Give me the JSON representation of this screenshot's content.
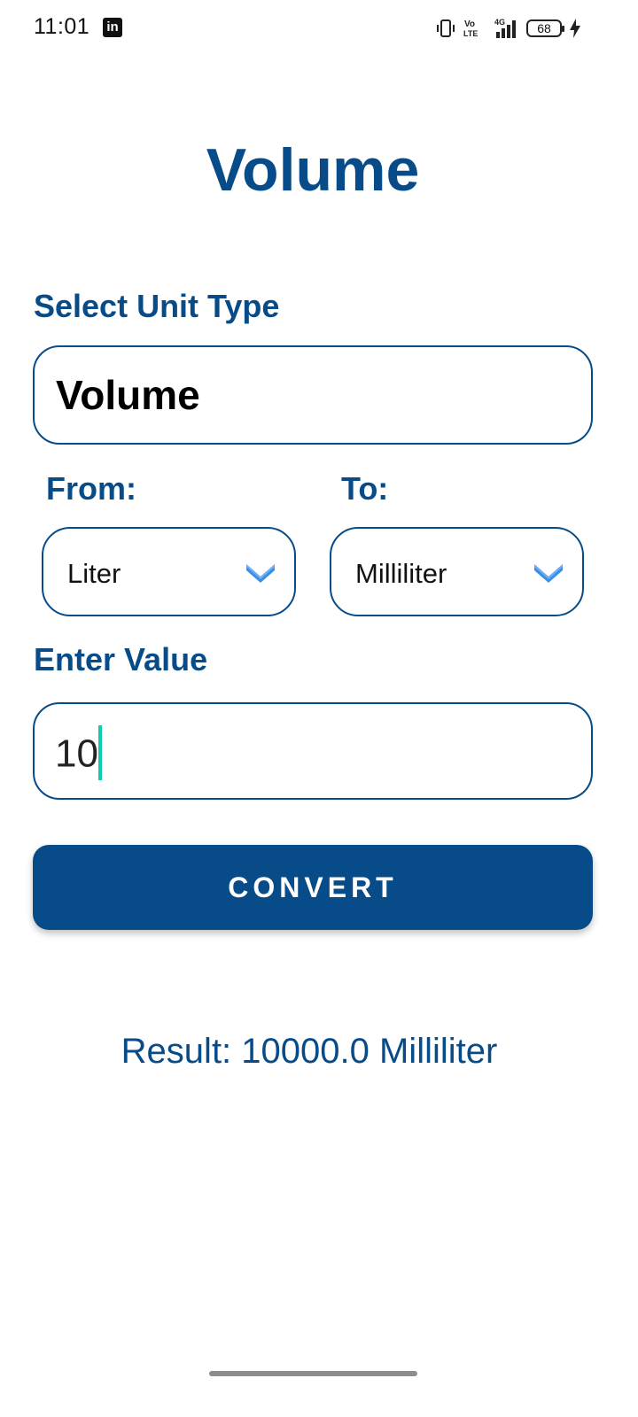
{
  "status_bar": {
    "time": "11:01",
    "notification_icon": "linkedin-icon",
    "linkedin_letters": "in",
    "volte_top": "Vo",
    "volte_bottom": "LTE",
    "network": "4G",
    "battery_level": "68",
    "icons": [
      "vibrate-icon",
      "volte-icon",
      "signal-4g-icon",
      "battery-icon",
      "charging-icon"
    ]
  },
  "page": {
    "title": "Volume"
  },
  "unit_type": {
    "label": "Select Unit Type",
    "value": "Volume"
  },
  "from": {
    "label": "From:",
    "value": "Liter"
  },
  "to": {
    "label": "To:",
    "value": "Milliliter"
  },
  "input": {
    "label": "Enter Value",
    "value": "10"
  },
  "actions": {
    "convert_label": "CONVERT"
  },
  "result": {
    "text": "Result: 10000.0 Milliliter"
  },
  "colors": {
    "primary": "#074c89",
    "chevron": "#3a8ee6",
    "caret": "#10cdb0",
    "background": "#ffffff"
  }
}
